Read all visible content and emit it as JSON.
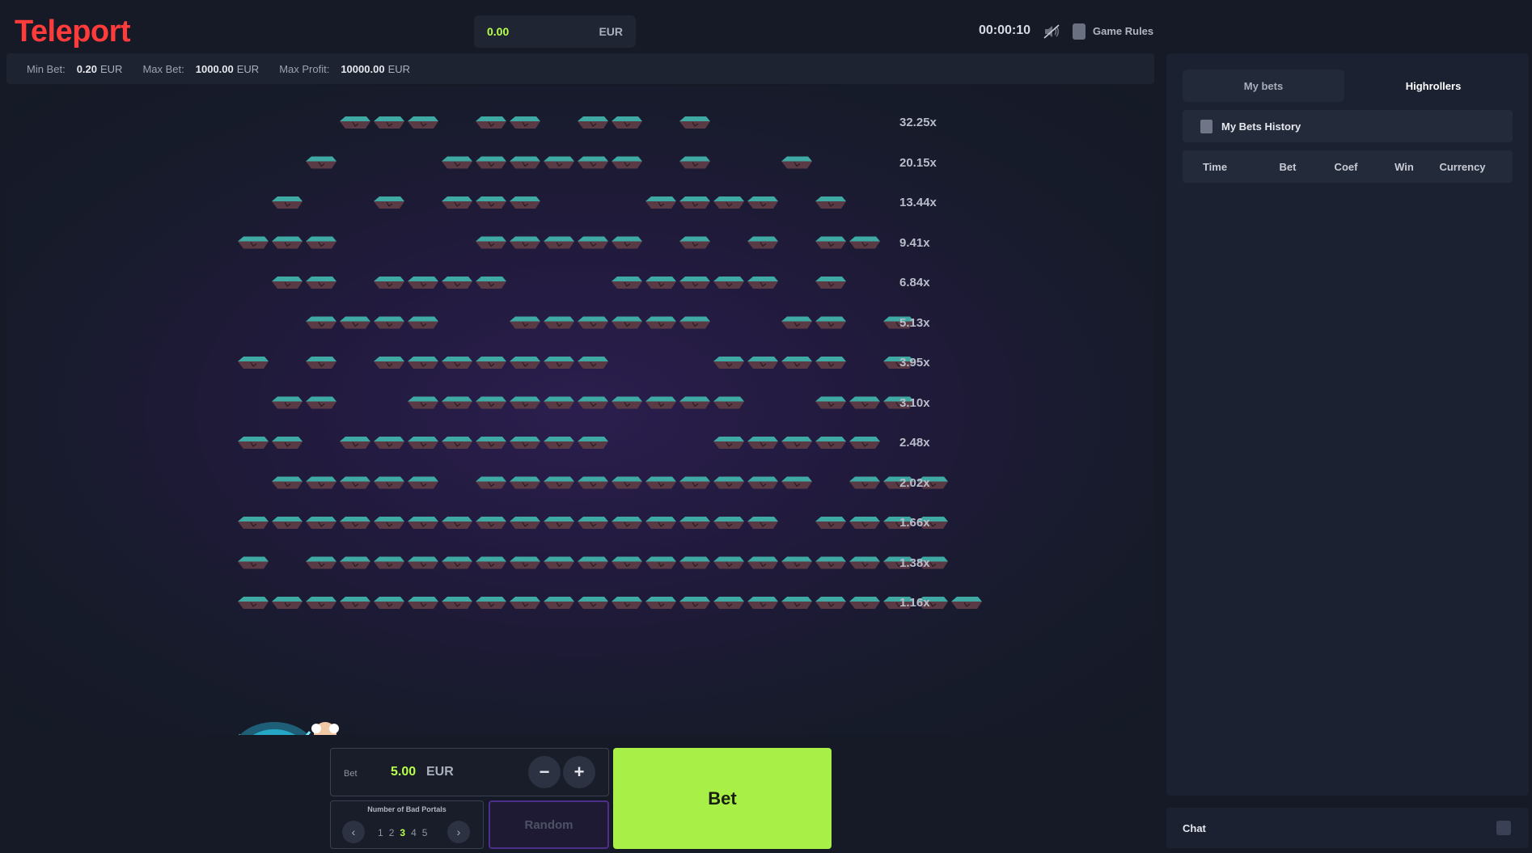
{
  "header": {
    "logo": "Teleport",
    "balance": "0.00",
    "balance_currency": "EUR",
    "timer": "00:00:10",
    "rules_label": "Game Rules"
  },
  "limits": {
    "min_label": "Min Bet:",
    "min_value": "0.20",
    "min_currency": "EUR",
    "max_label": "Max Bet:",
    "max_value": "1000.00",
    "max_currency": "EUR",
    "profit_label": "Max Profit:",
    "profit_value": "10000.00",
    "profit_currency": "EUR"
  },
  "rows": [
    {
      "mult": "32.25x",
      "pattern": "....111.11.11.1..."
    },
    {
      "mult": "20.15x",
      "pattern": "...1...111111.1..1."
    },
    {
      "mult": "13.44x",
      "pattern": "..1..1.111...1111.1"
    },
    {
      "mult": "9.41x",
      "pattern": ".111....11111.1.1.11"
    },
    {
      "mult": "6.84x",
      "pattern": "..11.1111...11111.1"
    },
    {
      "mult": "5.13x",
      "pattern": "...1111..111111..11.1"
    },
    {
      "mult": "3.95x",
      "pattern": ".1.1.1111111...1111.1"
    },
    {
      "mult": "3.10x",
      "pattern": "..11..1111111111..111"
    },
    {
      "mult": "2.48x",
      "pattern": ".11.11111111...11111"
    },
    {
      "mult": "2.02x",
      "pattern": "..11111.1111111111.111"
    },
    {
      "mult": "1.66x",
      "pattern": ".1111111111111111.1111"
    },
    {
      "mult": "1.38x",
      "pattern": ".1.1111111111111111111"
    },
    {
      "mult": "1.16x",
      "pattern": ".1111111111111111111111"
    }
  ],
  "controls": {
    "bet_label": "Bet",
    "bet_value": "5.00",
    "bet_currency": "EUR",
    "minus": "−",
    "plus": "+",
    "bad_portals_title": "Number of Bad Portals",
    "portal_options": [
      "1",
      "2",
      "3",
      "4",
      "5"
    ],
    "selected_portals": "3",
    "prev": "‹",
    "next": "›",
    "random_label": "Random",
    "bet_button": "Bet"
  },
  "sidebar": {
    "tab_my_bets": "My bets",
    "tab_highrollers": "Highrollers",
    "history_title": "My Bets History",
    "columns": [
      "Time",
      "Bet",
      "Coef",
      "Win",
      "Currency"
    ]
  },
  "chat": {
    "title": "Chat"
  },
  "colors": {
    "brand": "#ff3b3b",
    "accent": "#b7ff4a",
    "bet_button": "#a8f048",
    "toggle": "#8a3ff0"
  },
  "icons": {
    "sound": "sound-off-icon",
    "rules": "rules-icon",
    "history": "history-icon",
    "chat": "expand-icon"
  }
}
